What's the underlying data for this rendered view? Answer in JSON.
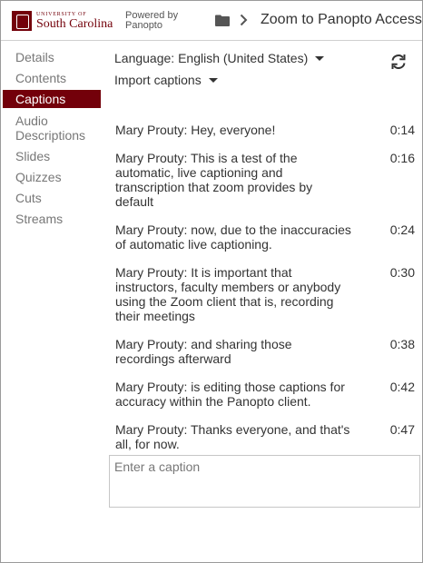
{
  "header": {
    "logo_small": "UNIVERSITY OF",
    "logo_big": "South Carolina",
    "powered_line1": "Powered by",
    "powered_line2": "Panopto",
    "title": "Zoom to Panopto Access"
  },
  "sidebar": {
    "items": [
      {
        "label": "Details"
      },
      {
        "label": "Contents"
      },
      {
        "label": "Captions"
      },
      {
        "label": "Audio Descriptions"
      },
      {
        "label": "Slides"
      },
      {
        "label": "Quizzes"
      },
      {
        "label": "Cuts"
      },
      {
        "label": "Streams"
      }
    ],
    "active": "Captions"
  },
  "toolbar": {
    "language_label": "Language: English (United States)",
    "import_label": "Import captions"
  },
  "captions": [
    {
      "text": "Mary Prouty: Hey, everyone!",
      "time": "0:14"
    },
    {
      "text": "Mary Prouty: This is a test of the automatic, live captioning and transcription that zoom provides by default",
      "time": "0:16"
    },
    {
      "text": "Mary Prouty: now, due to the inaccuracies of automatic live captioning.",
      "time": "0:24"
    },
    {
      "text": "Mary Prouty: It is important that instructors, faculty members or anybody using the Zoom client that is, recording their meetings",
      "time": "0:30"
    },
    {
      "text": "Mary Prouty: and sharing those recordings afterward",
      "time": "0:38"
    },
    {
      "text": "Mary Prouty: is editing those captions for accuracy within the Panopto client.",
      "time": "0:42"
    },
    {
      "text": "Mary Prouty: Thanks everyone, and that's all, for now.",
      "time": "0:47"
    }
  ],
  "caption_input": {
    "placeholder": "Enter a caption",
    "value": ""
  },
  "colors": {
    "brand": "#73000a",
    "active_nav_bg": "#73000a"
  },
  "icons": {
    "folder": "folder-icon",
    "breadcrumb_separator": "chevron-right-icon",
    "refresh": "refresh-icon",
    "dropdown": "caret-down-icon"
  }
}
